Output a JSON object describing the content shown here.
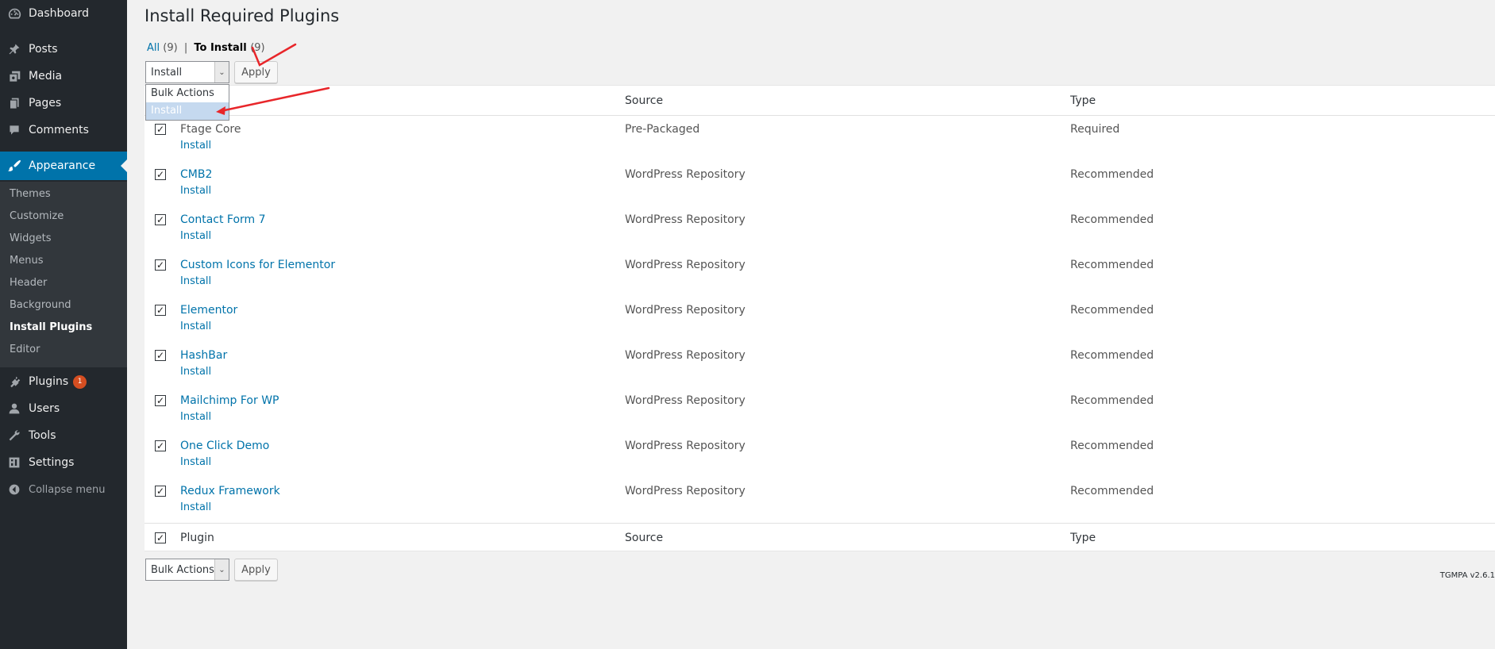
{
  "sidebar": {
    "items": [
      {
        "label": "Dashboard",
        "icon": "dashboard-icon"
      },
      {
        "label": "Posts",
        "icon": "pin-icon"
      },
      {
        "label": "Media",
        "icon": "media-icon"
      },
      {
        "label": "Pages",
        "icon": "pages-icon"
      },
      {
        "label": "Comments",
        "icon": "comment-icon"
      },
      {
        "label": "Appearance",
        "icon": "paintbrush-icon"
      },
      {
        "label": "Plugins",
        "icon": "plugin-icon",
        "badge": "1"
      },
      {
        "label": "Users",
        "icon": "user-icon"
      },
      {
        "label": "Tools",
        "icon": "wrench-icon"
      },
      {
        "label": "Settings",
        "icon": "settings-icon"
      },
      {
        "label": "Collapse menu",
        "icon": "collapse-icon"
      }
    ],
    "submenu": [
      "Themes",
      "Customize",
      "Widgets",
      "Menus",
      "Header",
      "Background",
      "Install Plugins",
      "Editor"
    ],
    "colors": {
      "background": "#23282d",
      "active": "#0073aa",
      "submenu": "#32373c"
    }
  },
  "page": {
    "title": "Install Required Plugins",
    "filters": {
      "all_label": "All",
      "all_count": "(9)",
      "separator": "|",
      "to_install_label": "To Install",
      "to_install_count": "(9)"
    }
  },
  "bulk_top": {
    "selected": "Install",
    "options": [
      "Bulk Actions",
      "Install"
    ],
    "apply_label": "Apply"
  },
  "bulk_bottom": {
    "selected": "Bulk Actions",
    "apply_label": "Apply"
  },
  "table": {
    "columns": {
      "source": "Source",
      "type": "Type"
    },
    "footer": {
      "plugin": "Plugin",
      "source": "Source",
      "type": "Type"
    },
    "rows": [
      {
        "name": "Ftage Core",
        "action": "Install",
        "source": "Pre-Packaged",
        "type": "Required",
        "checked": true
      },
      {
        "name": "CMB2",
        "action": "Install",
        "source": "WordPress Repository",
        "type": "Recommended",
        "checked": true
      },
      {
        "name": "Contact Form 7",
        "action": "Install",
        "source": "WordPress Repository",
        "type": "Recommended",
        "checked": true
      },
      {
        "name": "Custom Icons for Elementor",
        "action": "Install",
        "source": "WordPress Repository",
        "type": "Recommended",
        "checked": true
      },
      {
        "name": "Elementor",
        "action": "Install",
        "source": "WordPress Repository",
        "type": "Recommended",
        "checked": true
      },
      {
        "name": "HashBar",
        "action": "Install",
        "source": "WordPress Repository",
        "type": "Recommended",
        "checked": true
      },
      {
        "name": "Mailchimp For WP",
        "action": "Install",
        "source": "WordPress Repository",
        "type": "Recommended",
        "checked": true
      },
      {
        "name": "One Click Demo",
        "action": "Install",
        "source": "WordPress Repository",
        "type": "Recommended",
        "checked": true
      },
      {
        "name": "Redux Framework",
        "action": "Install",
        "source": "WordPress Repository",
        "type": "Recommended",
        "checked": true
      }
    ]
  },
  "version": "TGMPA v2.6.1",
  "annotation_color": "#e8262a"
}
